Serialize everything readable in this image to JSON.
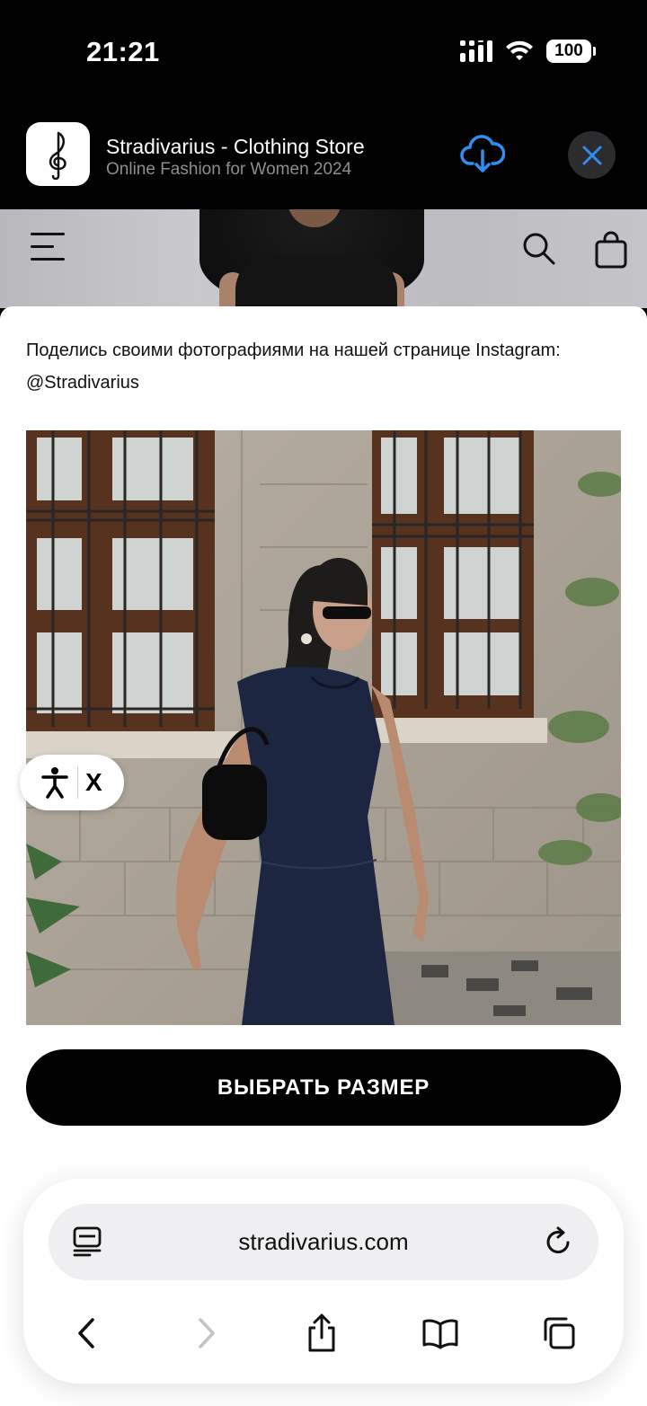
{
  "status_bar": {
    "time": "21:21",
    "battery": "100"
  },
  "app_banner": {
    "title": "Stradivarius - Clothing Store",
    "subtitle": "Online Fashion for Women 2024",
    "accent": "#2f8ff0"
  },
  "site_header": {
    "menu_icon": "hamburger-icon",
    "search_icon": "search-icon",
    "bag_icon": "shopping-bag-icon"
  },
  "sheet": {
    "share_text": "Поделись своими фотографиями на нашей странице Instagram: @Stradivarius",
    "accessibility_close": "X",
    "size_button": "ВЫБРАТЬ РАЗМЕР"
  },
  "browser": {
    "url": "stradivarius.com",
    "nav": [
      "back-icon",
      "forward-icon",
      "share-icon",
      "bookmarks-icon",
      "tabs-icon"
    ]
  }
}
